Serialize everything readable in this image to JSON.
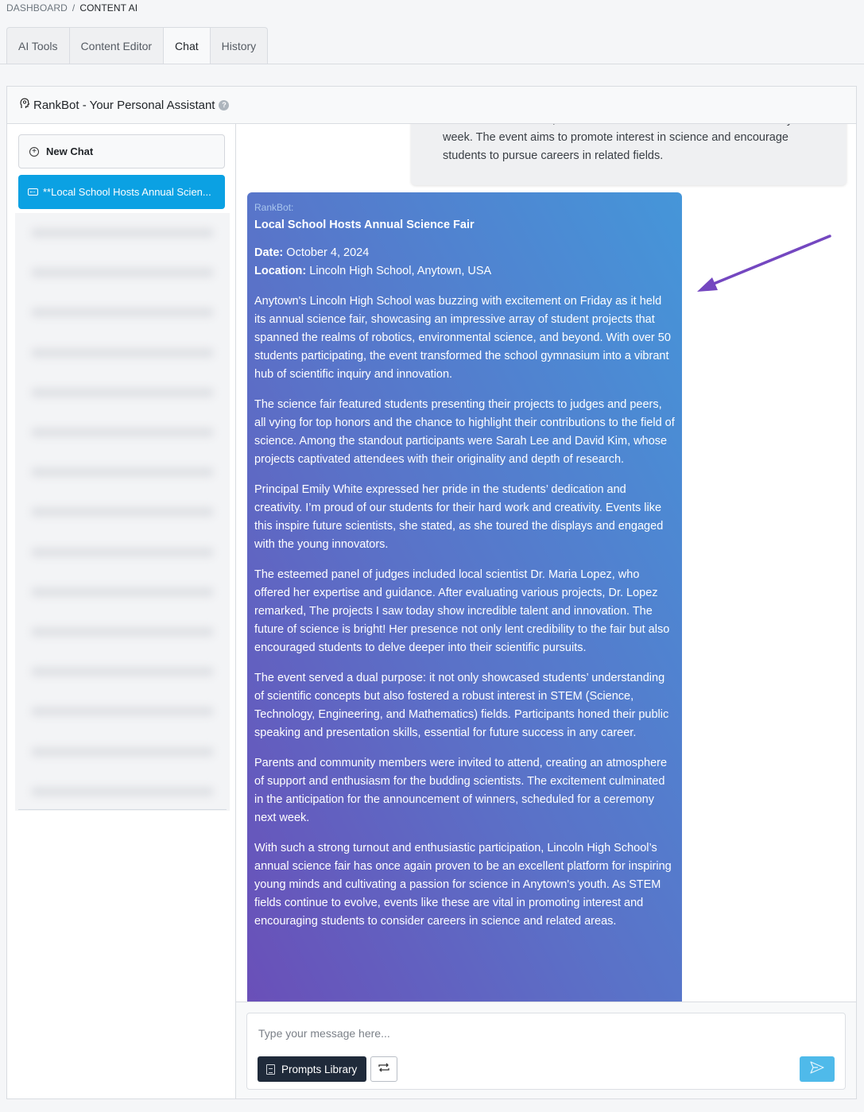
{
  "breadcrumb": {
    "items": [
      "DASHBOARD",
      "CONTENT AI"
    ],
    "separator": "/"
  },
  "tabs": [
    {
      "label": "AI Tools",
      "active": false
    },
    {
      "label": "Content Editor",
      "active": false
    },
    {
      "label": "Chat",
      "active": true
    },
    {
      "label": "History",
      "active": false
    }
  ],
  "panel": {
    "title": "RankBot - Your Personal Assistant",
    "help_icon": "question-circle-icon",
    "title_icon": "bot-head-icon"
  },
  "sidebar": {
    "new_chat_label": "New Chat",
    "active_chat_label": "**Local School Hosts Annual Scien...",
    "blurred_chat_count": 15
  },
  "messages": {
    "user_message_visible_lines": [
      "were invited to attend, and winners will be announced at a ceremony next",
      "week. The event aims to promote interest in science and encourage",
      "students to pursue careers in related fields."
    ],
    "bot": {
      "sender": "RankBot:",
      "title": "Local School Hosts Annual Science Fair",
      "date_label": "Date:",
      "date_value": "October 4, 2024",
      "location_label": "Location:",
      "location_value": "Lincoln High School, Anytown, USA",
      "paragraphs": [
        "Anytown's Lincoln High School was buzzing with excitement on Friday as it held its annual science fair, showcasing an impressive array of student projects that spanned the realms of robotics, environmental science, and beyond. With over 50 students participating, the event transformed the school gymnasium into a vibrant hub of scientific inquiry and innovation.",
        "The science fair featured students presenting their projects to judges and peers, all vying for top honors and the chance to highlight their contributions to the field of science. Among the standout participants were Sarah Lee and David Kim, whose projects captivated attendees with their originality and depth of research.",
        "Principal Emily White expressed her pride in the students’ dedication and creativity. I’m proud of our students for their hard work and creativity. Events like this inspire future scientists, she stated, as she toured the displays and engaged with the young innovators.",
        "The esteemed panel of judges included local scientist Dr. Maria Lopez, who offered her expertise and guidance. After evaluating various projects, Dr. Lopez remarked, The projects I saw today show incredible talent and innovation. The future of science is bright! Her presence not only lent credibility to the fair but also encouraged students to delve deeper into their scientific pursuits.",
        "The event served a dual purpose: it not only showcased students’ understanding of scientific concepts but also fostered a robust interest in STEM (Science, Technology, Engineering, and Mathematics) fields. Participants honed their public speaking and presentation skills, essential for future success in any career.",
        "Parents and community members were invited to attend, creating an atmosphere of support and enthusiasm for the budding scientists. The excitement culminated in the anticipation for the announcement of winners, scheduled for a ceremony next week.",
        "With such a strong turnout and enthusiastic participation, Lincoln High School’s annual science fair has once again proven to be an excellent platform for inspiring young minds and cultivating a passion for science in Anytown's youth. As STEM fields continue to evolve, events like these are vital in promoting interest and encouraging students to consider careers in science and related areas."
      ]
    }
  },
  "composer": {
    "placeholder": "Type your message here...",
    "value": "",
    "prompts_library_label": "Prompts Library",
    "repeat_icon": "repeat-icon",
    "send_icon": "send-icon"
  },
  "annotation": {
    "arrow_color": "#7447c0"
  },
  "colors": {
    "accent": "#0ba1e3",
    "send_button": "#4fbaea",
    "prompts_button": "#1f2a3a",
    "bot_gradient_top": "#4596d9",
    "bot_gradient_bottom": "#6a4fb8"
  }
}
